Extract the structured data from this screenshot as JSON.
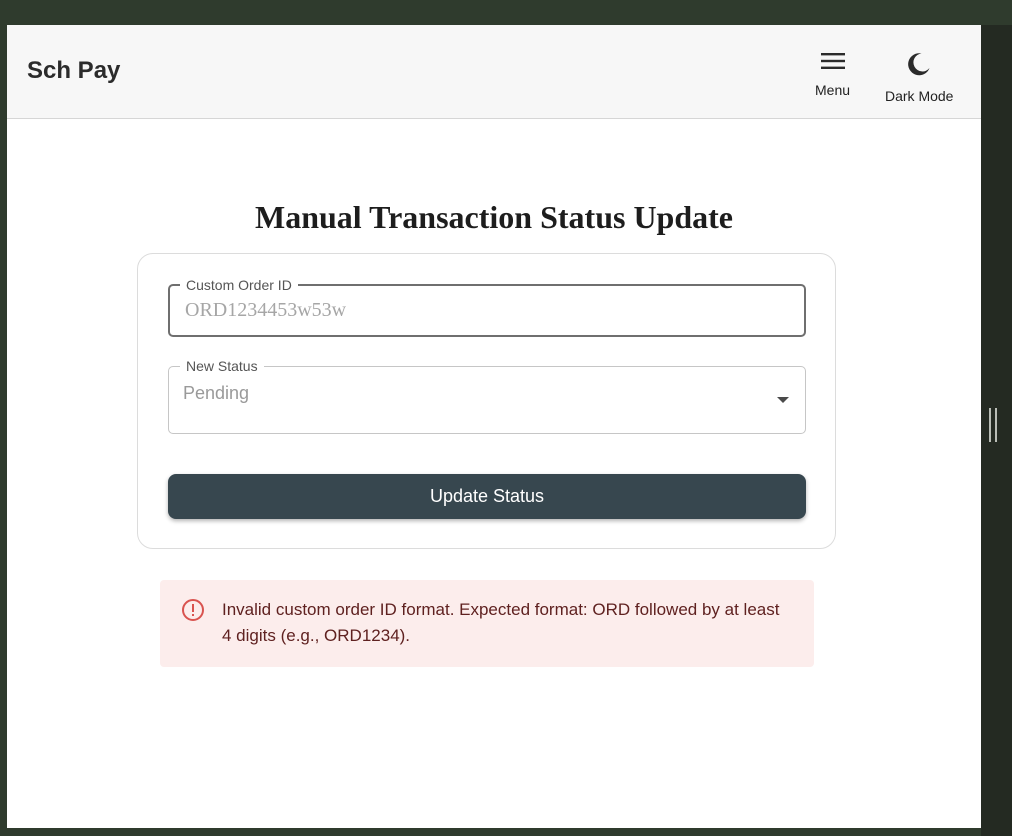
{
  "header": {
    "brand": "Sch Pay",
    "menu_label": "Menu",
    "dark_mode_label": "Dark Mode"
  },
  "page": {
    "title": "Manual Transaction Status Update"
  },
  "form": {
    "order_id": {
      "label": "Custom Order ID",
      "value": "",
      "placeholder": "ORD1234453w53w"
    },
    "status": {
      "label": "New Status",
      "selected": "Pending"
    },
    "submit_label": "Update Status"
  },
  "alert": {
    "severity": "error",
    "message": "Invalid custom order ID format. Expected format: ORD followed by at least 4 digits (e.g., ORD1234)."
  },
  "colors": {
    "primary_button": "#37474f",
    "alert_bg": "#fcedec",
    "alert_icon": "#d9534f",
    "alert_text": "#5f2120"
  },
  "icons": {
    "menu": "hamburger-icon",
    "dark_mode": "moon-icon",
    "alert": "error-outline-icon",
    "select": "chevron-down-icon"
  }
}
